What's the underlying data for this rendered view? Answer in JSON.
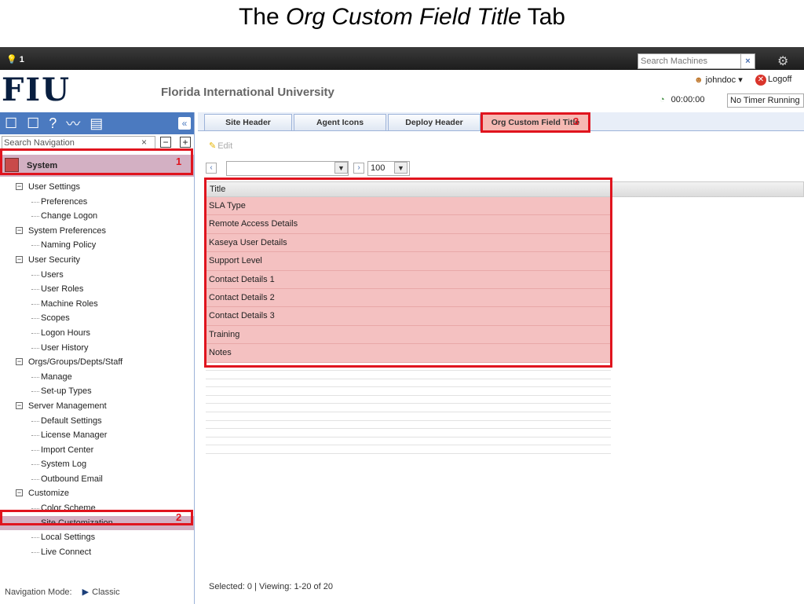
{
  "slide": {
    "title_prefix": "The ",
    "title_em": "Org Custom Field Title",
    "title_suffix": " Tab"
  },
  "topbar": {
    "alert_count": "1",
    "search_placeholder": "Search Machines",
    "clear_label": "×",
    "gear": "⚙"
  },
  "header": {
    "logo": "FIU",
    "university": "Florida International University",
    "user": "johndoc ▾",
    "logoff": "Logoff",
    "timer_value": "00:00:00",
    "timer_status": "No Timer Running"
  },
  "sidebar": {
    "search_placeholder": "Search Navigation",
    "module": "System",
    "callout_1": "1",
    "callout_2": "2",
    "items": [
      {
        "label": "User Settings",
        "level": "parent"
      },
      {
        "label": "Preferences",
        "level": "child"
      },
      {
        "label": "Change Logon",
        "level": "child"
      },
      {
        "label": "System Preferences",
        "level": "parent"
      },
      {
        "label": "Naming Policy",
        "level": "child"
      },
      {
        "label": "User Security",
        "level": "parent"
      },
      {
        "label": "Users",
        "level": "child"
      },
      {
        "label": "User Roles",
        "level": "child"
      },
      {
        "label": "Machine Roles",
        "level": "child"
      },
      {
        "label": "Scopes",
        "level": "child"
      },
      {
        "label": "Logon Hours",
        "level": "child"
      },
      {
        "label": "User History",
        "level": "child"
      },
      {
        "label": "Orgs/Groups/Depts/Staff",
        "level": "parent"
      },
      {
        "label": "Manage",
        "level": "child"
      },
      {
        "label": "Set-up Types",
        "level": "child"
      },
      {
        "label": "Server Management",
        "level": "parent"
      },
      {
        "label": "Default Settings",
        "level": "child"
      },
      {
        "label": "License Manager",
        "level": "child"
      },
      {
        "label": "Import Center",
        "level": "child"
      },
      {
        "label": "System Log",
        "level": "child"
      },
      {
        "label": "Outbound Email",
        "level": "child"
      },
      {
        "label": "Customize",
        "level": "parent"
      },
      {
        "label": "Color Scheme",
        "level": "child"
      },
      {
        "label": "Site Customization",
        "level": "child",
        "selected": true
      },
      {
        "label": "Local Settings",
        "level": "child"
      },
      {
        "label": "Live Connect",
        "level": "child"
      }
    ],
    "nav_mode_label": "Navigation Mode:",
    "nav_mode_value": "Classic"
  },
  "main": {
    "tabs": [
      {
        "label": "Site Header"
      },
      {
        "label": "Agent Icons"
      },
      {
        "label": "Deploy Header"
      },
      {
        "label": "Org Custom Field Title",
        "active": true
      }
    ],
    "callout_3": "3",
    "edit_label": "Edit",
    "page_size": "100",
    "column_header": "Title",
    "rows": [
      "SLA Type",
      "Remote Access Details",
      "Kaseya User Details",
      "Support Level",
      "Contact Details 1",
      "Contact Details 2",
      "Contact Details 3",
      "Training",
      "Notes"
    ],
    "footer": "Selected:  0  |  Viewing:  1-20  of  20"
  },
  "colors": {
    "accent": "#4b7ac0",
    "highlight": "#e0141e",
    "selected": "#d3b0c3",
    "row_highlight": "#f4c1c1"
  }
}
